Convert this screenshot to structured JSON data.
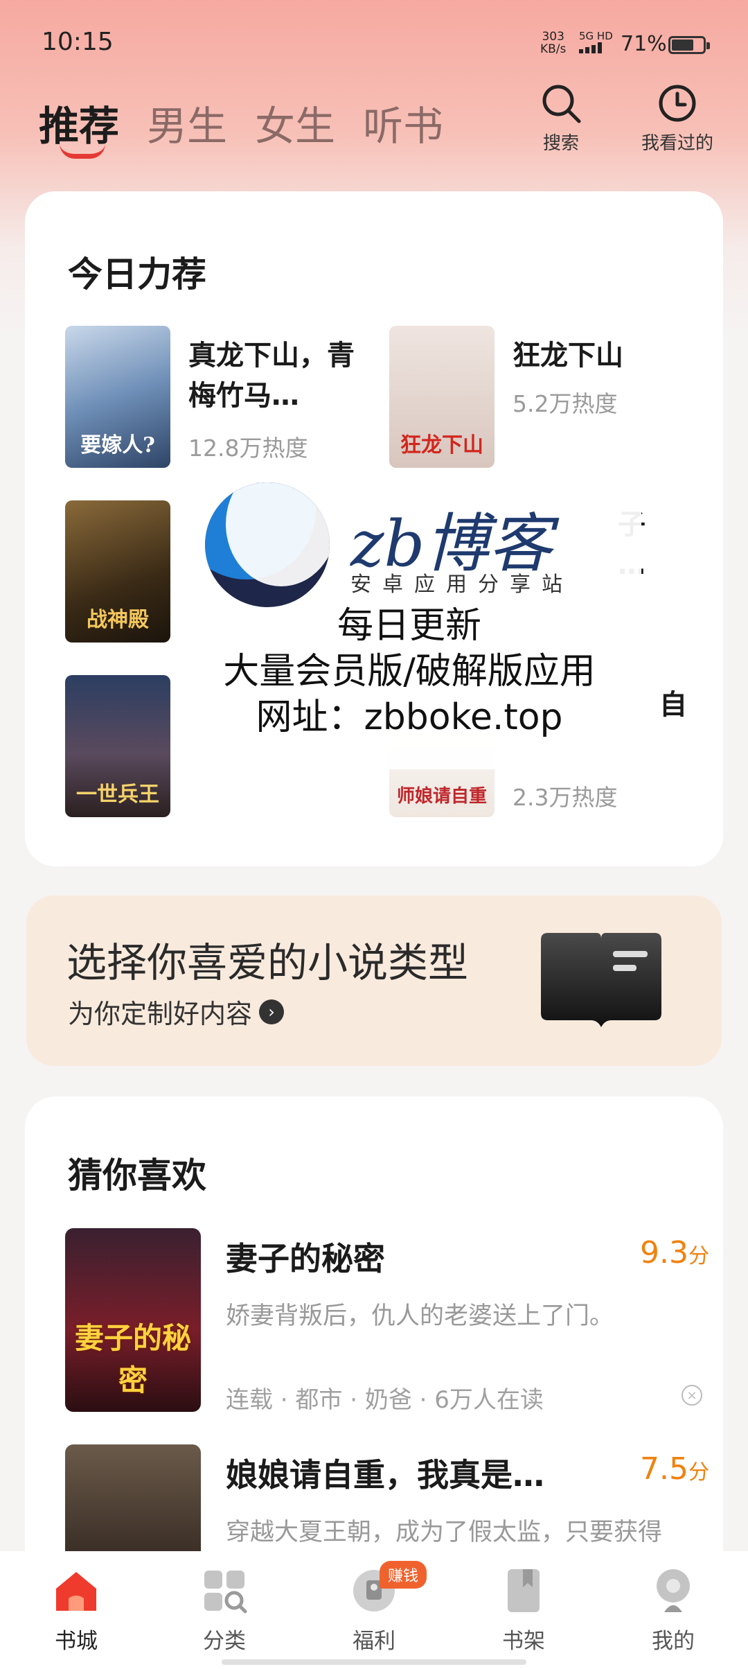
{
  "status_bar": {
    "time": "10:15",
    "net_speed": "303",
    "net_unit": "KB/s",
    "signal": "5G HD",
    "battery": "71%",
    "battery_level": 0.71
  },
  "top_tabs": [
    {
      "label": "推荐",
      "active": true
    },
    {
      "label": "男生",
      "active": false
    },
    {
      "label": "女生",
      "active": false
    },
    {
      "label": "听书",
      "active": false
    }
  ],
  "header_actions": {
    "search_label": "搜索",
    "history_label": "我看过的"
  },
  "today": {
    "title": "今日力荐",
    "items": [
      {
        "title": "真龙下山，青梅竹马…",
        "heat": "12.8万热度",
        "cover_text": "要嫁人?",
        "cover_color": "#5d7fa8"
      },
      {
        "title": "狂龙下山",
        "heat": "5.2万热度",
        "cover_text": "狂龙下山",
        "cover_color": "#e8d8d2"
      },
      {
        "title": "子",
        "heat": "",
        "cover_text": "战神殿",
        "cover_color": "#3a2a1a"
      },
      {
        "title": "…",
        "heat": "",
        "cover_text": "",
        "cover_color": ""
      },
      {
        "title": "",
        "heat": "",
        "cover_text": "一世兵王",
        "cover_color": "#3b2f3f"
      },
      {
        "title": "自",
        "heat": "2.3万热度",
        "cover_text": "师娘请自重",
        "cover_color": "#f3ece6"
      }
    ]
  },
  "watermark": {
    "brand": "zb博客",
    "subtitle": "安卓应用分享站",
    "line1": "每日更新",
    "line2": "大量会员版/破解版应用",
    "line3": "网址：zbboke.top"
  },
  "banner": {
    "title": "选择你喜爱的小说类型",
    "subtitle": "为你定制好内容"
  },
  "guess": {
    "title": "猜你喜欢",
    "items": [
      {
        "title": "妻子的秘密",
        "score": "9.3",
        "score_unit": "分",
        "desc": "娇妻背叛后，仇人的老婆送上了门。",
        "meta": "连载 · 都市 · 奶爸 · 6万人在读",
        "cover_text": "妻子的秘密"
      },
      {
        "title": "娘娘请自重，我真是…",
        "score": "7.5",
        "score_unit": "分",
        "desc": "穿越大夏王朝，成为了假太监，只要获得",
        "meta": "",
        "cover_text": ""
      }
    ]
  },
  "bottom_nav": [
    {
      "label": "书城",
      "icon": "home-icon",
      "active": true
    },
    {
      "label": "分类",
      "icon": "category-icon",
      "active": false
    },
    {
      "label": "福利",
      "icon": "gift-icon",
      "active": false,
      "badge": "赚钱"
    },
    {
      "label": "书架",
      "icon": "bookshelf-icon",
      "active": false
    },
    {
      "label": "我的",
      "icon": "profile-icon",
      "active": false
    }
  ],
  "colors": {
    "accent": "#e53935",
    "score": "#f0820f",
    "badge": "#f0622d"
  }
}
